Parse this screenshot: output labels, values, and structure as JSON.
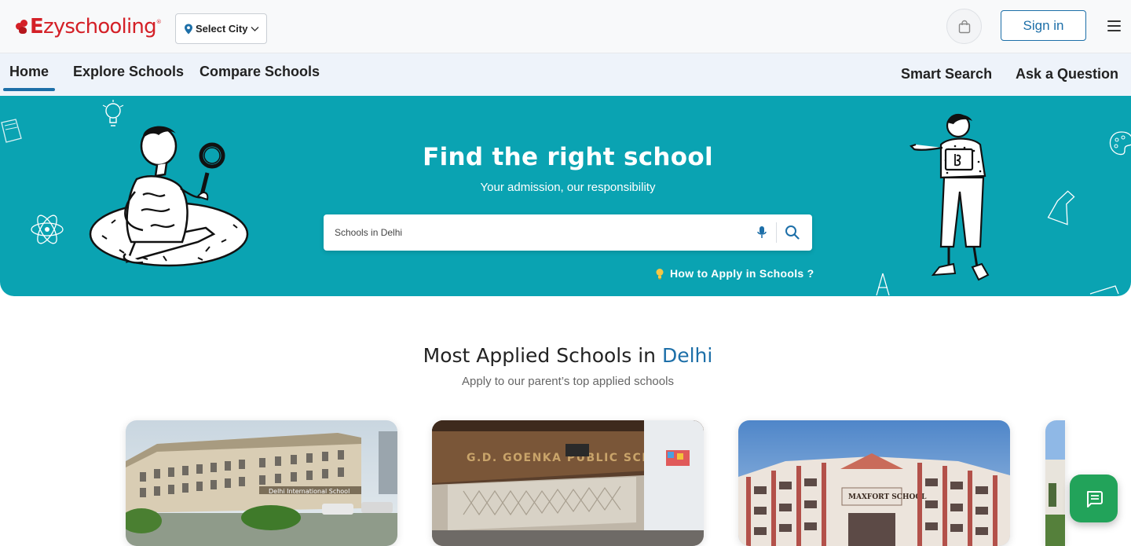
{
  "header": {
    "logo": {
      "first_letter": "E",
      "brand": "zyschooling",
      "reg_mark": "®"
    },
    "city_select_label": "Select City",
    "signin_label": "Sign in",
    "icons": {
      "cart": "shopping-bag-icon",
      "menu": "hamburger-menu-icon",
      "city": "location-pin-icon"
    }
  },
  "nav": {
    "home": "Home",
    "explore": "Explore Schools",
    "compare": "Compare Schools",
    "smart_search": "Smart Search",
    "ask": "Ask a Question"
  },
  "hero": {
    "title": "Find the right school",
    "subtitle": "Your admission, our responsibility",
    "search_placeholder": "Schools in Delhi",
    "how_to_apply": "How to Apply in Schools ?",
    "icons": {
      "mic": "microphone-icon",
      "search": "search-icon",
      "bulb": "lightbulb-icon"
    }
  },
  "section": {
    "title_prefix": "Most Applied Schools in ",
    "city": "Delhi",
    "subtitle": "Apply to our parent’s top applied schools"
  },
  "school_cards": [
    {
      "sign": "Delhi International School"
    },
    {
      "sign": "G.D. GOENKA PUBLIC SCHOOL"
    },
    {
      "sign": "MAXFORT SCHOOL"
    }
  ],
  "colors": {
    "brand_red": "#d42027",
    "primary_blue": "#1d6fa8",
    "hero_teal": "#0aa3b2",
    "chat_green": "#22a35a"
  }
}
